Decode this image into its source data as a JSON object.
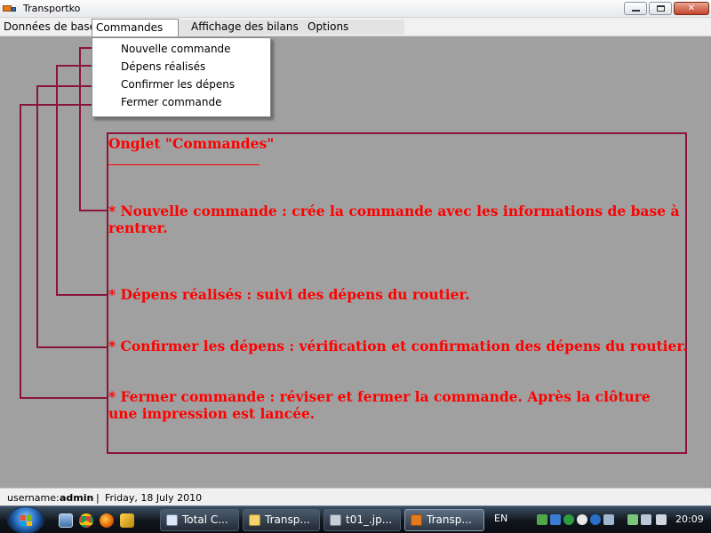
{
  "window": {
    "title": "Transportko",
    "buttons": [
      "minimize",
      "maximize",
      "close"
    ]
  },
  "menubar": {
    "items": [
      "Données de base",
      "Commandes",
      "Affichage des bilans",
      "Options"
    ]
  },
  "dropdown": {
    "items": [
      "Nouvelle commande",
      "Dépens réalisés",
      "Confirmer les dépens",
      "Fermer commande"
    ]
  },
  "annotation": {
    "heading": "Onglet \"Commandes\"",
    "underline": "____________________",
    "lines": [
      "* Nouvelle commande :  crée la commande avec les informations de base à",
      "rentrer.",
      "* Dépens réalisés : suivi des dépens du routier.",
      "* Confirmer les dépens : vérification et confirmation des dépens du routier.",
      "* Fermer commande : réviser et fermer la commande. Après la clôture",
      "une impression est lancée."
    ],
    "color": "#ff0000",
    "frame_color": "#8a1538"
  },
  "status": {
    "label": "username:",
    "user": "admin",
    "separator": "|",
    "date": "Friday, 18 July 2010"
  },
  "taskbar": {
    "buttons": [
      "Total C...",
      "Transp...",
      "t01_.jp...",
      "Transp..."
    ],
    "active_index": 3,
    "language": "EN",
    "clock": "20:09",
    "quick_launch_icons": [
      "show-desktop-icon",
      "chrome-icon",
      "firefox-icon",
      "pen-icon"
    ],
    "tray_icons": [
      "network-icon",
      "shield-icon",
      "sync-icon",
      "circle-icon",
      "b-icon",
      "monitor-icon",
      "battery-icon",
      "speaker-icon"
    ]
  }
}
